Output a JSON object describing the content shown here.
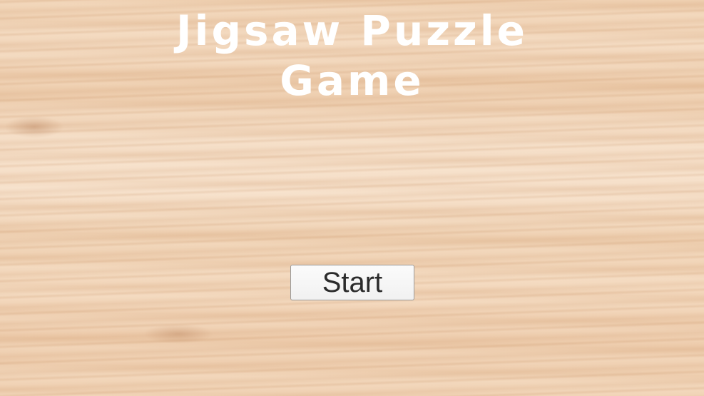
{
  "game": {
    "title_line1": "Jigsaw Puzzle",
    "title_line2": "Game",
    "start_label": "Start"
  },
  "colors": {
    "title_text": "#ffffff",
    "button_background": "#f2f2f2",
    "button_text": "#2b2b2b",
    "background_wood": "#f0d2b4"
  }
}
